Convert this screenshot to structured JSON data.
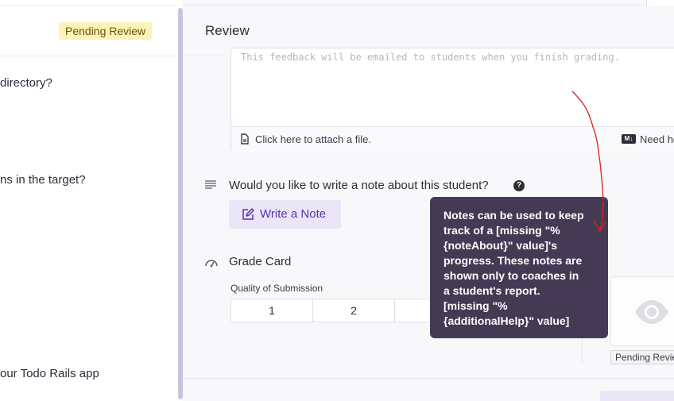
{
  "left_pane": {
    "status_badge": "Pending Review",
    "questions": [
      "directory?",
      "ns in the target?",
      "our Todo Rails app"
    ]
  },
  "review": {
    "title": "Review",
    "feedback_placeholder": "This feedback will be emailed to students when you finish grading.",
    "attach_label": "Click here to attach a file.",
    "markdown_badge": "M↓",
    "markdown_help": "Need help",
    "note_question": "Would you like to write a note about this student?",
    "write_note_label": "Write a Note",
    "grade_card_title": "Grade Card",
    "quality_label": "Quality of Submission",
    "grades": [
      "1",
      "2",
      ""
    ],
    "preview_status": "Pending Review"
  },
  "tooltip": {
    "lines": [
      "Notes can be used to keep",
      "track of a [missing \"%",
      "{noteAbout}\" value]'s",
      "progress. These notes are",
      "shown only to coaches in",
      "a student's report.",
      "[missing \"%",
      "{additionalHelp}\" value]"
    ]
  },
  "colors": {
    "accent": "#5b2fb1",
    "accent_bg": "#ebe6f7",
    "badge_bg": "#fcf3b9",
    "tooltip_bg": "#453a53",
    "annotation": "#e0201b"
  },
  "icons": [
    "attachment-icon",
    "markdown-icon",
    "note-lines-icon",
    "help-icon",
    "edit-icon",
    "gauge-icon",
    "eye-icon"
  ]
}
